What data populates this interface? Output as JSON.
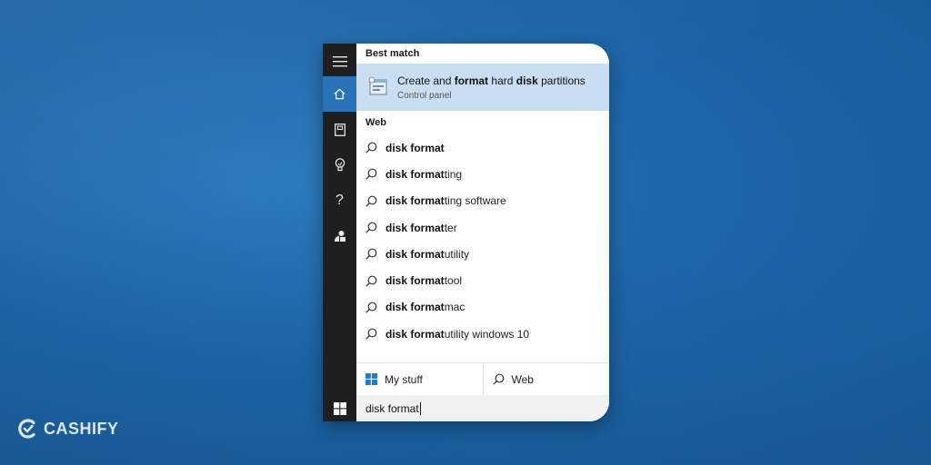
{
  "sidebar": {
    "items": [
      {
        "icon": "hamburger-menu-icon"
      },
      {
        "icon": "home-icon"
      },
      {
        "icon": "notebook-icon"
      },
      {
        "icon": "lightbulb-icon"
      },
      {
        "icon": "question-mark-icon",
        "glyph": "?"
      },
      {
        "icon": "feedback-icon"
      }
    ],
    "start_icon": "windows-logo-icon"
  },
  "best_match": {
    "label": "Best match",
    "title_parts": [
      "Create and ",
      "format",
      " hard ",
      "disk",
      " partitions"
    ],
    "subtitle": "Control panel"
  },
  "web": {
    "label": "Web",
    "items": [
      {
        "bold": "disk format",
        "rest": ""
      },
      {
        "bold": "disk format",
        "rest": "ting"
      },
      {
        "bold": "disk format",
        "rest": "ting software"
      },
      {
        "bold": "disk format",
        "rest": "ter"
      },
      {
        "bold": "disk format",
        "rest": " utility"
      },
      {
        "bold": "disk format",
        "rest": " tool"
      },
      {
        "bold": "disk format",
        "rest": " mac"
      },
      {
        "bold": "disk format",
        "rest": " utility windows 10"
      }
    ]
  },
  "bottom": {
    "my_stuff": "My stuff",
    "web": "Web"
  },
  "search": {
    "value": "disk format"
  },
  "brand": {
    "logo_text": "CASHIFY"
  },
  "colors": {
    "accent": "#2a73b8",
    "highlight": "#c9def3",
    "sidebar": "#1f1f1f",
    "background": "#1d66a8"
  }
}
